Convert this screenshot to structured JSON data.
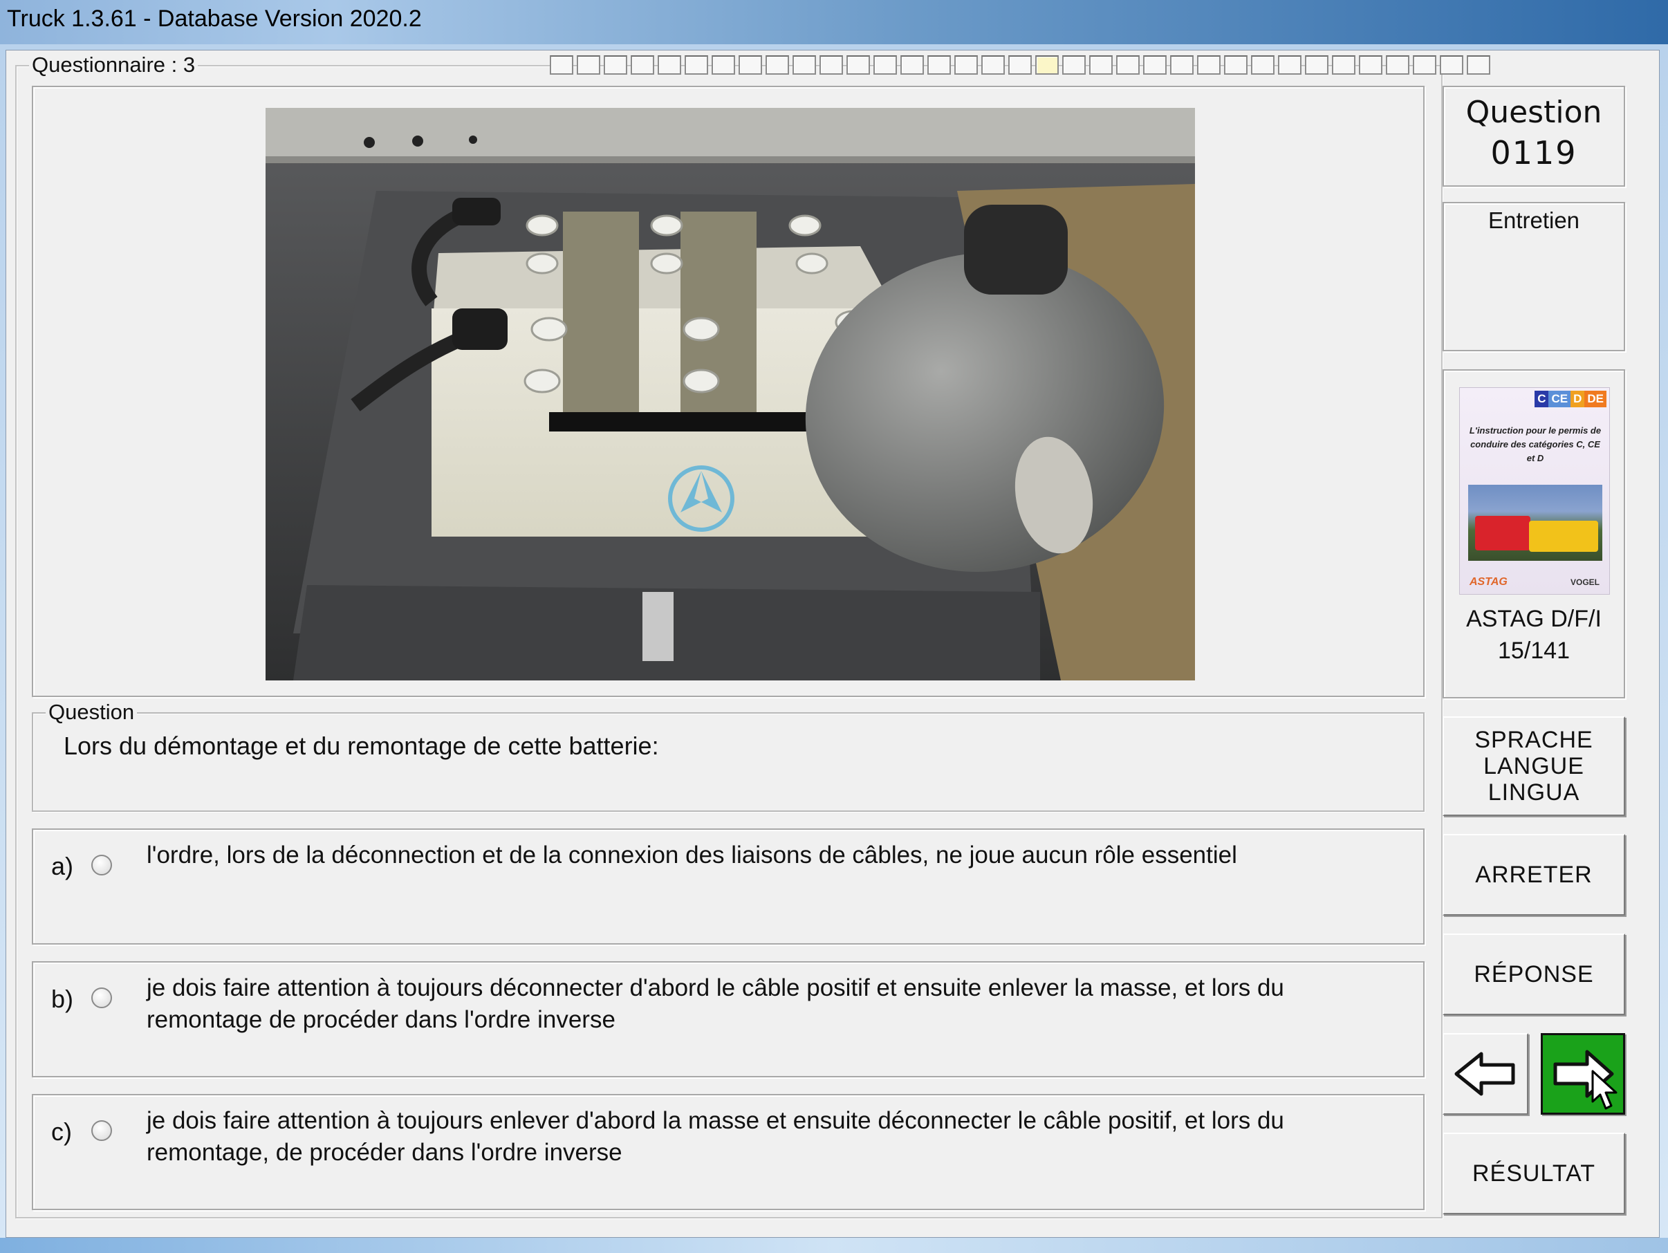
{
  "window": {
    "title": "Truck 1.3.61 - Database Version 2020.2"
  },
  "questionnaire": {
    "label": "Questionnaire : 3",
    "progress_total": 35,
    "progress_current_index": 18
  },
  "question_header": {
    "title_line1": "Question",
    "number": "0119"
  },
  "category": {
    "label": "Entretien"
  },
  "book": {
    "badges": [
      "C",
      "CE",
      "D",
      "DE"
    ],
    "cover_text": "L'instruction pour le permis de conduire des catégories C, CE et D",
    "publisher_left": "ASTAG",
    "publisher_right": "VOGEL",
    "caption_line1": "ASTAG D/F/I",
    "caption_line2": "15/141"
  },
  "question": {
    "legend": "Question",
    "text": "Lors du démontage et du remontage de cette batterie:"
  },
  "answers": [
    {
      "letter": "a)",
      "text_line1": "l'ordre, lors de la déconnection et de la connexion des liaisons de câbles, ne joue aucun rôle essentiel",
      "text_line2": ""
    },
    {
      "letter": "b)",
      "text_line1": "je dois faire attention à toujours déconnecter d'abord le câble positif et ensuite enlever la masse, et lors du",
      "text_line2": "remontage de procéder dans l'ordre inverse"
    },
    {
      "letter": "c)",
      "text_line1": "je dois faire attention à toujours enlever d'abord la masse et ensuite  déconnecter le câble positif, et lors du",
      "text_line2": "remontage, de procéder dans l'ordre inverse"
    }
  ],
  "buttons": {
    "language_line1": "SPRACHE",
    "language_line2": "LANGUE",
    "language_line3": "LINGUA",
    "stop": "ARRETER",
    "answer": "RÉPONSE",
    "result": "RÉSULTAT"
  },
  "colors": {
    "next_button_bg": "#1aa21a",
    "progress_current": "#fbf6c8"
  },
  "icons": {
    "prev": "arrow-left-icon",
    "next": "arrow-right-icon",
    "cursor": "mouse-cursor-icon"
  }
}
